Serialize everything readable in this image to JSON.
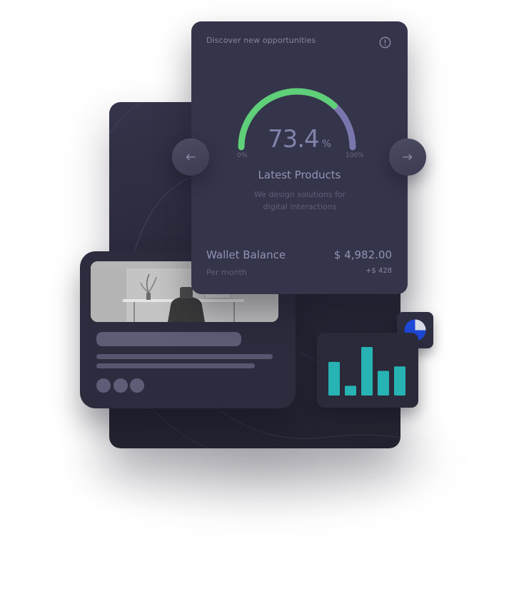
{
  "card": {
    "tagline": "Discover new opportunities",
    "info_icon": "info-circle-icon",
    "gauge": {
      "value": 73.4,
      "value_text": "73.4",
      "unit": "%",
      "min_label": "0%",
      "max_label": "100%",
      "colors": {
        "filled": "#5fcf79",
        "remaining": "#7a76ad"
      }
    },
    "product_title": "Latest Products",
    "product_desc_line1": "We design solutions for",
    "product_desc_line2": "digital interactions",
    "wallet": {
      "label": "Wallet Balance",
      "value": "$ 4,982.00",
      "sub_label": "Per month",
      "delta": "+$ 428"
    }
  },
  "nav": {
    "prev_icon": "arrow-left-icon",
    "next_icon": "arrow-right-icon"
  },
  "pie_widget": {
    "icon": "pie-chart-icon",
    "colors": {
      "slice": "#1e48d8",
      "rest": "#d9dce8"
    }
  },
  "chart_data": {
    "type": "bar",
    "values": [
      52,
      15,
      75,
      38,
      45
    ],
    "ylim": [
      0,
      75
    ],
    "color": "#27b2b3",
    "grid": false
  },
  "colors": {
    "card_bg": "#34344a",
    "panel_bg": "#262636",
    "accent_green": "#5fcf79",
    "accent_purple": "#7a76ad",
    "accent_teal": "#27b2b3",
    "text_muted": "#8686a6"
  }
}
